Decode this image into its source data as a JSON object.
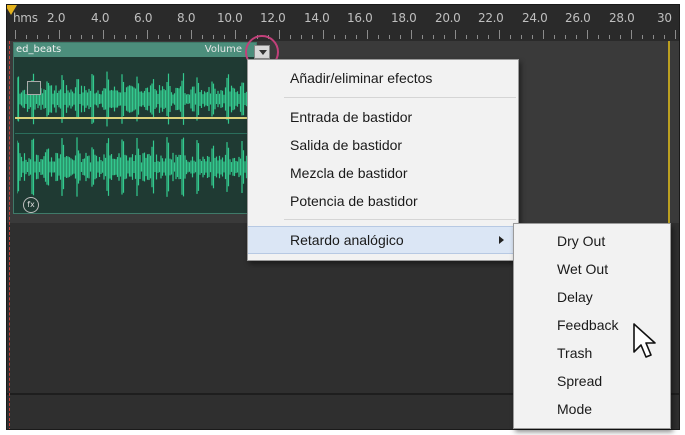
{
  "ruler": {
    "labels": [
      "hms",
      "2.0",
      "4.0",
      "6.0",
      "8.0",
      "10.0",
      "12.0",
      "14.0",
      "16.0",
      "18.0",
      "20.0",
      "22.0",
      "24.0",
      "26.0",
      "28.0",
      "30"
    ]
  },
  "clip": {
    "name": "ed_beats",
    "volume_label": "Volume"
  },
  "context_menu": {
    "add_remove_effects": "Añadir/eliminar efectos",
    "rack_input": "Entrada de bastidor",
    "rack_output": "Salida de bastidor",
    "rack_mix": "Mezcla de bastidor",
    "rack_power": "Potencia de bastidor",
    "analog_delay": "Retardo analógico"
  },
  "submenu": {
    "items": [
      "Dry Out",
      "Wet Out",
      "Delay",
      "Feedback",
      "Trash",
      "Spread",
      "Mode"
    ]
  },
  "colors": {
    "waveform": "#33c98e",
    "highlight_circle": "#c2407a",
    "playhead": "#e3b21d"
  },
  "icons": {
    "volume_dropdown": "triangle-down",
    "submenu_arrow": "triangle-right",
    "cursor": "arrow-pointer",
    "fx": "fx-badge"
  }
}
